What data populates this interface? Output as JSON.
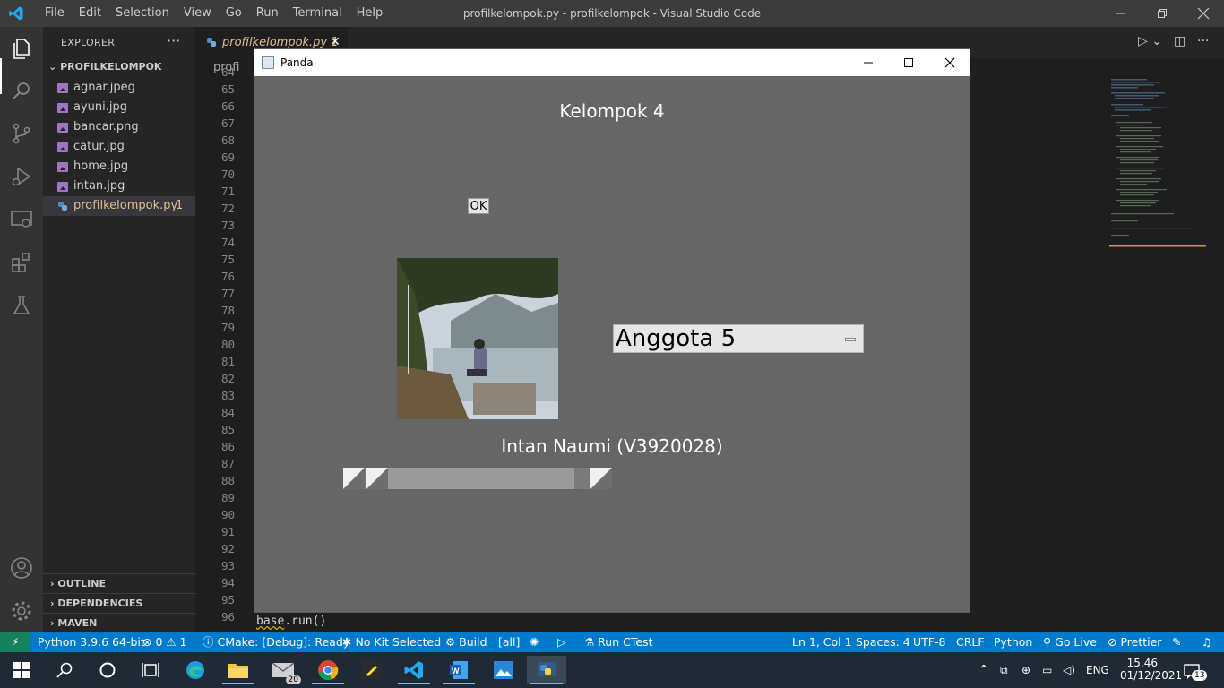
{
  "vscode": {
    "menu": [
      "File",
      "Edit",
      "Selection",
      "View",
      "Go",
      "Run",
      "Terminal",
      "Help"
    ],
    "window_title": "profilkelompok.py - profilkelompok - Visual Studio Code",
    "explorer": {
      "title": "EXPLORER",
      "more": "···",
      "folder": "PROFILKELOMPOK",
      "files": [
        "agnar.jpeg",
        "ayuni.jpg",
        "bancar.png",
        "catur.jpg",
        "home.jpg",
        "intan.jpg"
      ],
      "active_file": "profilkelompok.py",
      "active_badge": "1",
      "sections": [
        "OUTLINE",
        "DEPENDENCIES",
        "MAVEN"
      ]
    },
    "tab": {
      "label": "profilkelompok.py 1",
      "close": "✕"
    },
    "breadcrumb": "profi",
    "line_numbers": [
      "64",
      "65",
      "66",
      "67",
      "68",
      "69",
      "70",
      "71",
      "72",
      "73",
      "74",
      "75",
      "76",
      "77",
      "78",
      "79",
      "80",
      "81",
      "82",
      "83",
      "84",
      "85",
      "86",
      "87",
      "88",
      "89",
      "90",
      "91",
      "92",
      "93",
      "94",
      "95",
      "96"
    ],
    "last_code_line": {
      "ident": "base",
      "rest": ".run()"
    }
  },
  "statusbar": {
    "remote": "⚡",
    "python": "Python 3.9.6 64-bit",
    "problems": "⊗ 0 ⚠ 1",
    "cmake": "ⓘ CMake: [Debug]: Ready",
    "kit": "✱ No Kit Selected",
    "build": "⚙ Build",
    "target": "[all]",
    "debug": "✺",
    "run": "▷",
    "ctest": "⚗ Run CTest",
    "position": "Ln 1, Col 1",
    "spaces": "Spaces: 4",
    "encoding": "UTF-8",
    "eol": "CRLF",
    "language": "Python",
    "golive": "⚲ Go Live",
    "prettier": "⊘ Prettier"
  },
  "panda": {
    "title": "Panda",
    "heading": "Kelompok 4",
    "ok_button": "OK",
    "option_menu_value": "Anggota 5",
    "member_name": "Intan Naumi (V3920028)",
    "slider_value": 0.15
  },
  "taskbar": {
    "mail_badge": "20",
    "language": "ENG",
    "time": "15.46",
    "date": "01/12/2021",
    "notifications": "13"
  },
  "colors": {
    "accent": "#007acc",
    "remote": "#16825d",
    "panda_bg": "#666666",
    "modified_file": "#e2c08d"
  }
}
